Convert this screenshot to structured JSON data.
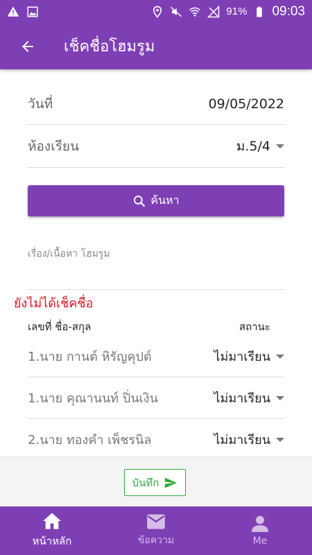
{
  "status_bar": {
    "battery": "91%",
    "time": "09:03"
  },
  "app_bar": {
    "title": "เช็คชื่อโฮมรูม"
  },
  "form": {
    "date_label": "วันที่",
    "date_value": "09/05/2022",
    "class_label": "ห้องเรียน",
    "class_value": "ม.5/4",
    "search_label": "ค้นหา",
    "topic_placeholder": "เรื่อง/เนื้อหา โฮมรูม"
  },
  "unchecked_title": "ยังไม่ได้เช็คชื่อ",
  "list_header": {
    "name": "เลขที่ ชื่อ-สกุล",
    "status": "สถานะ"
  },
  "students": [
    {
      "name": "1.นาย กานต์ หิรัญคุปต์",
      "status": "ไม่มาเรียน"
    },
    {
      "name": "1.นาย คุณานนท์ ปิ่นเงิน",
      "status": "ไม่มาเรียน"
    },
    {
      "name": "2.นาย ทองคำ เพ็ชรนิล",
      "status": "ไม่มาเรียน"
    }
  ],
  "save_label": "บันทึก",
  "bottom_nav": [
    {
      "label": "หน้าหลัก",
      "icon": "home-icon",
      "active": true
    },
    {
      "label": "ข้อความ",
      "icon": "mail-icon",
      "active": false
    },
    {
      "label": "Me",
      "icon": "person-icon",
      "active": false
    }
  ],
  "colors": {
    "primary": "#7e3fb5",
    "alert": "#e0141e",
    "save": "#2faa39"
  }
}
